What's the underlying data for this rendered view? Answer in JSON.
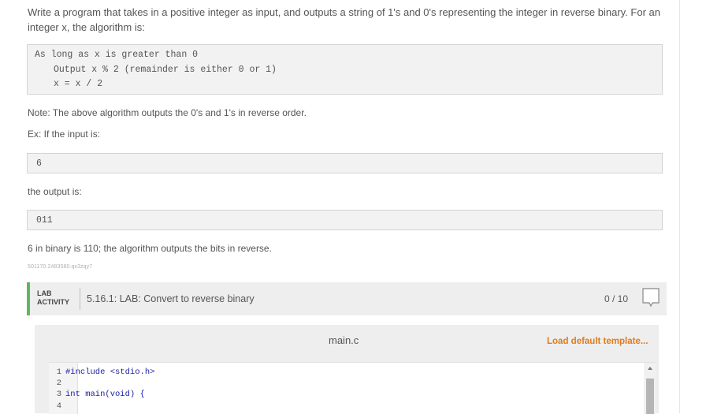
{
  "intro": "Write a program that takes in a positive integer as input, and outputs a string of 1's and 0's representing the integer in reverse binary. For an integer x, the algorithm is:",
  "algorithm": {
    "line1": "As long as x is greater than 0",
    "line2": "Output x % 2 (remainder is either 0 or 1)",
    "line3": "x = x / 2"
  },
  "note": "Note: The above algorithm outputs the 0's and 1's in reverse order.",
  "example_label": "Ex: If the input is:",
  "example_input": "6",
  "output_label": "the output is:",
  "example_output": "011",
  "binary_note": "6 in binary is 110; the algorithm outputs the bits in reverse.",
  "problem_id": "501170.2483580.qx3zqy7",
  "lab": {
    "label_line1": "LAB",
    "label_line2": "ACTIVITY",
    "title": "5.16.1: LAB: Convert to reverse binary",
    "score": "0 / 10",
    "accent_color": "#5cb85c"
  },
  "editor": {
    "filename": "main.c",
    "load_default": "Load default template...",
    "load_color": "#e07b1a",
    "lines": [
      {
        "num": "1",
        "text": "#include <stdio.h>"
      },
      {
        "num": "2",
        "text": ""
      },
      {
        "num": "3",
        "text": "int main(void) {"
      },
      {
        "num": "4",
        "text": ""
      }
    ]
  }
}
